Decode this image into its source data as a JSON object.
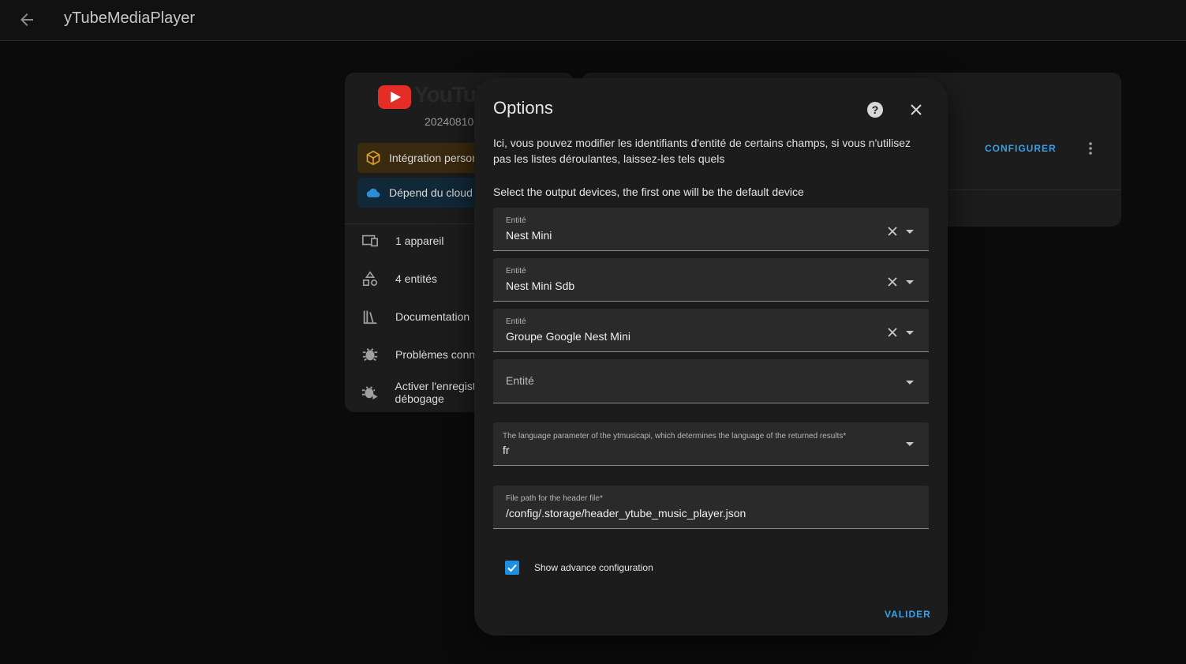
{
  "header": {
    "title": "yTubeMediaPlayer"
  },
  "integration_card": {
    "logo_text": "YouTube",
    "version": "20240810",
    "chips": {
      "custom": "Intégration personnalisée",
      "cloud": "Dépend du cloud"
    },
    "menu": {
      "devices": "1 appareil",
      "entities": "4 entités",
      "documentation": "Documentation",
      "issues": "Problèmes connus",
      "debug": "Activer l'enregistrement de débogage"
    }
  },
  "config_card": {
    "configure_label": "CONFIGURER"
  },
  "dialog": {
    "title": "Options",
    "description": "Ici, vous pouvez modifier les identifiants d'entité de certains champs, si vous n'utilisez pas les listes déroulantes, laissez-les tels quels",
    "devices_label": "Select the output devices, the first one will be the default device",
    "entity_fields": [
      {
        "label": "Entité",
        "value": "Nest Mini"
      },
      {
        "label": "Entité",
        "value": "Nest Mini Sdb"
      },
      {
        "label": "Entité",
        "value": "Groupe Google Nest Mini"
      }
    ],
    "empty_entity_placeholder": "Entité",
    "language_field": {
      "label": "The language parameter of the ytmusicapi, which determines the language of the returned results*",
      "value": "fr"
    },
    "header_path_field": {
      "label": "File path for the header file*",
      "value": "/config/.storage/header_ytube_music_player.json"
    },
    "advanced_checkbox": {
      "label": "Show advance configuration",
      "checked": true
    },
    "submit_label": "VALIDER"
  },
  "colors": {
    "accent": "#3ba1e6",
    "checkbox": "#1e8fe0",
    "youtube_red": "#e52d27"
  }
}
